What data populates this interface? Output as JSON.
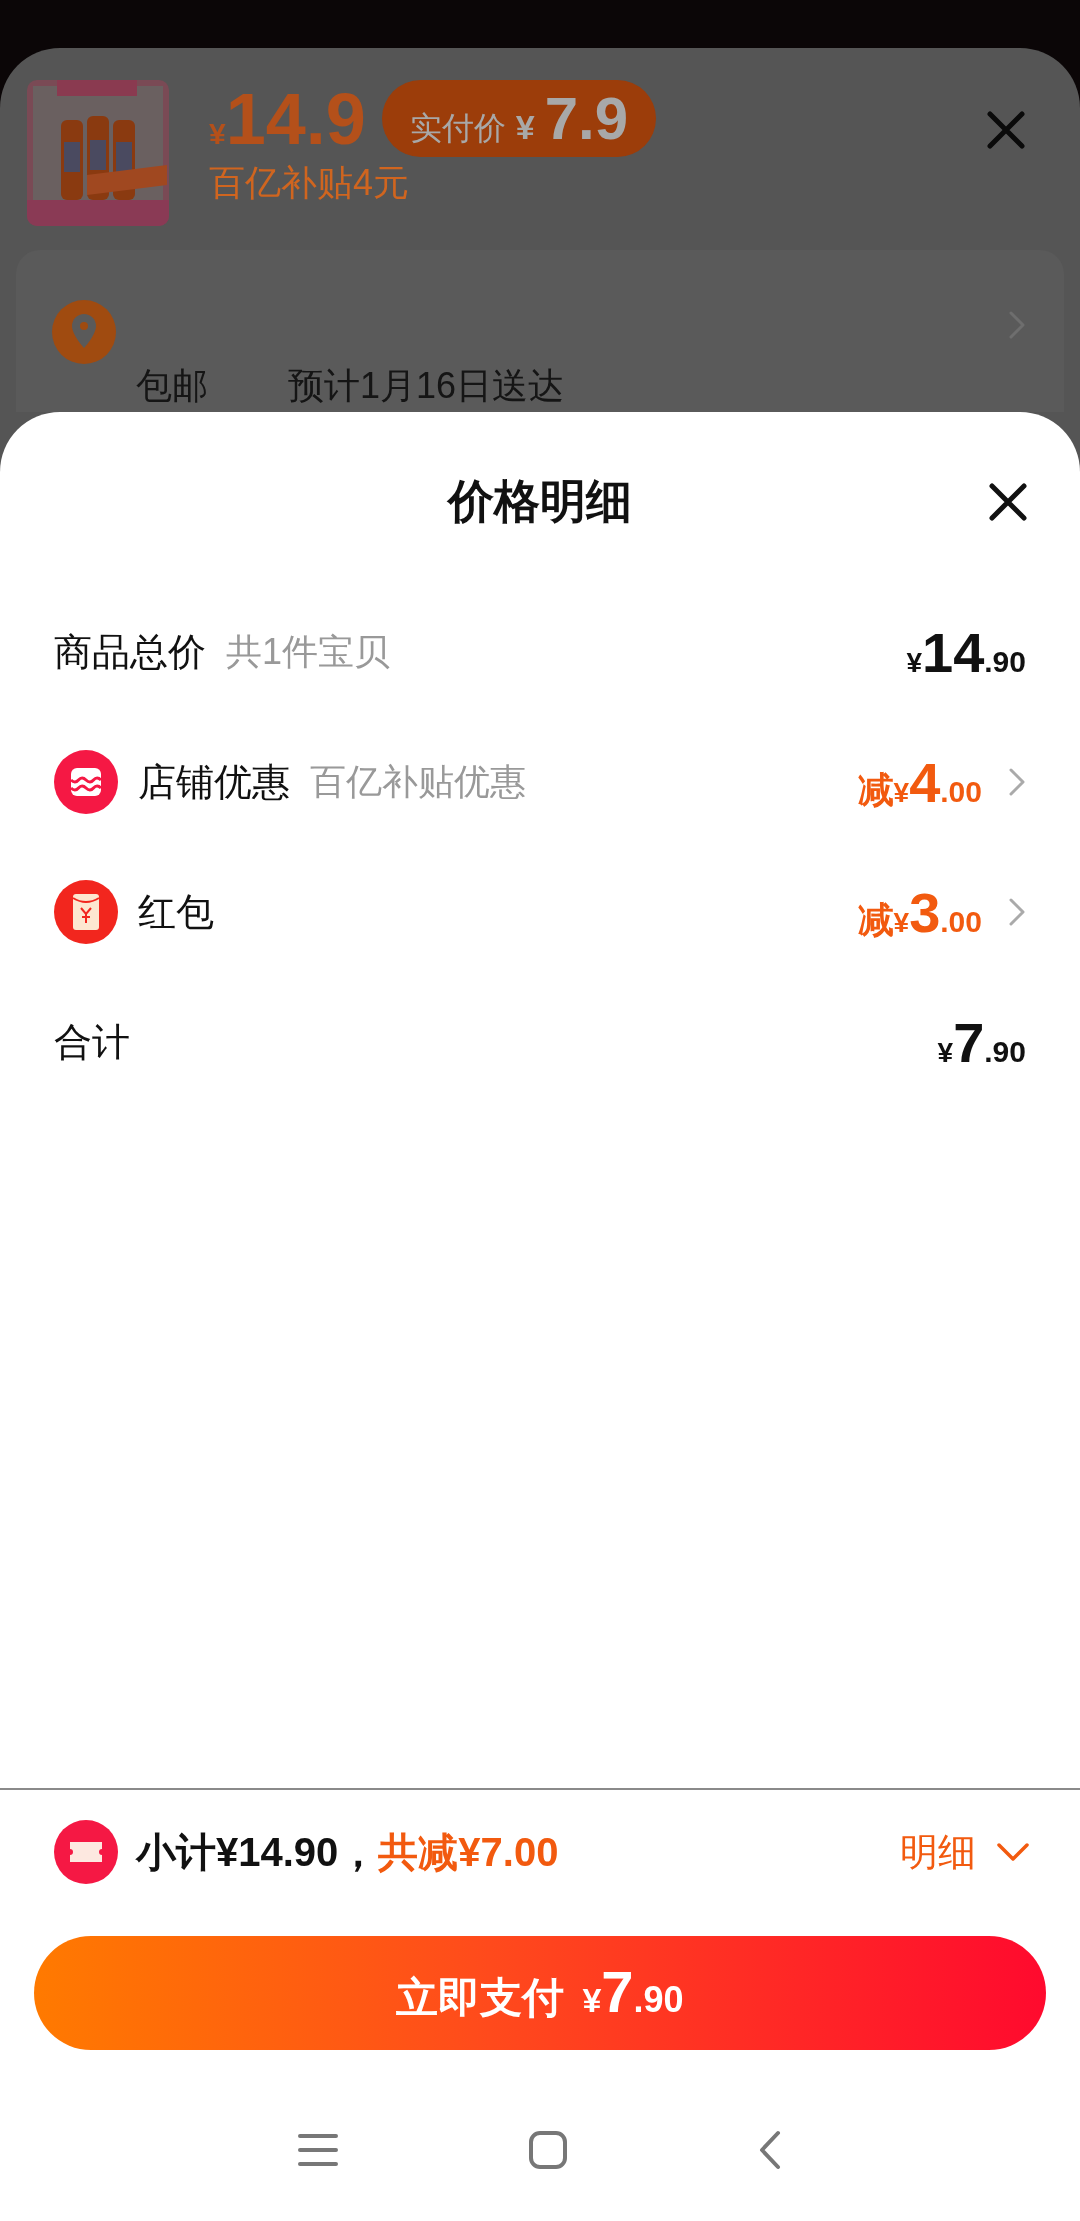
{
  "background_sheet": {
    "price": {
      "currency": "¥",
      "amount": "14.9"
    },
    "actual_price_badge": {
      "label": "实付价",
      "currency": "¥",
      "amount": "7.9"
    },
    "subsidy": "百亿补贴4元",
    "delivery": {
      "shipping": "包邮",
      "estimate": "预计1月16日送达"
    }
  },
  "price_sheet": {
    "title": "价格明细",
    "rows": [
      {
        "kind": "plain",
        "label": "商品总价",
        "note": "共1件宝贝",
        "currency": "¥",
        "integer": "14",
        "decimal": ".90"
      },
      {
        "kind": "discount",
        "label": "店铺优惠",
        "note": "百亿补贴优惠",
        "prefix": "减",
        "currency": "¥",
        "integer": "4",
        "decimal": ".00"
      },
      {
        "kind": "discount",
        "label": "红包",
        "prefix": "减",
        "currency": "¥",
        "integer": "3",
        "decimal": ".00"
      },
      {
        "kind": "plain",
        "label": "合计",
        "currency": "¥",
        "integer": "7",
        "decimal": ".90"
      }
    ]
  },
  "summary": {
    "subtotal": "小计¥14.90，",
    "reduction": "共减¥7.00",
    "details_link": "明细"
  },
  "pay_button": {
    "label": "立即支付",
    "currency": "¥",
    "integer": "7",
    "decimal": ".90"
  }
}
